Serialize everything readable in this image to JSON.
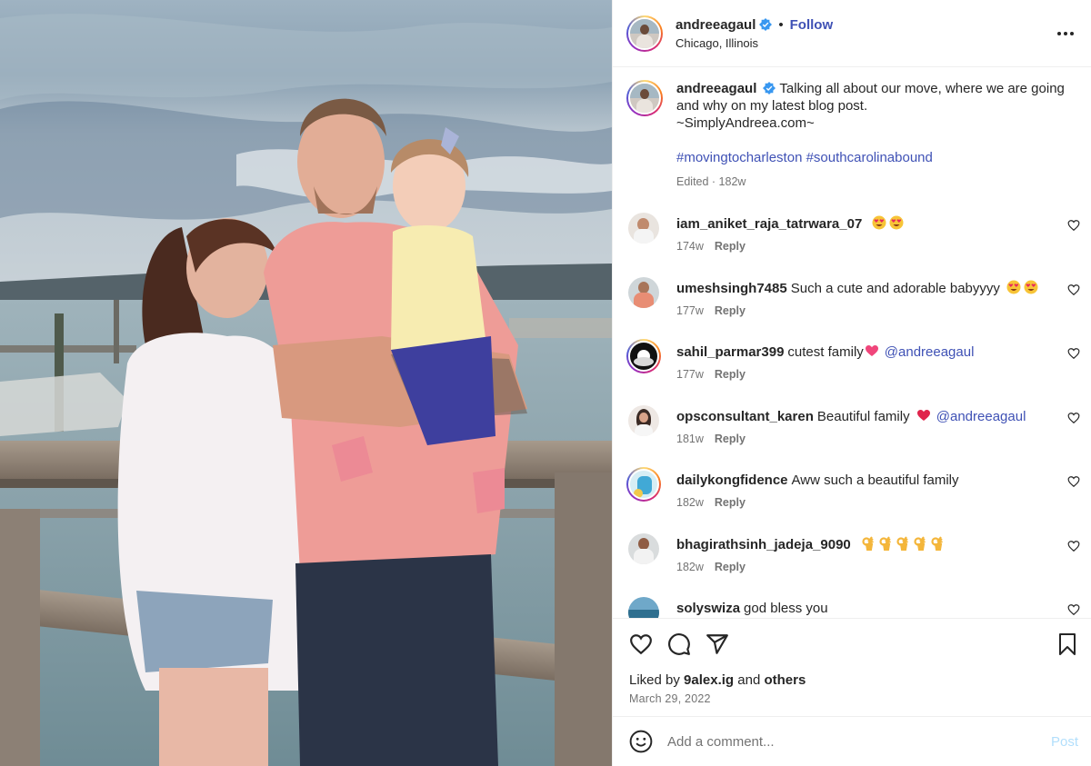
{
  "post": {
    "author": "andreeagaul",
    "location": "Chicago, Illinois",
    "follow_label": "Follow",
    "separator": "•",
    "caption": {
      "text_line": "Talking all about our move, where we are going and why on my latest blog post.",
      "site": "~SimplyAndreea.com~",
      "hashtags": "#movingtocharleston #southcarolinabound",
      "meta": "Edited · 182w"
    },
    "comments": [
      {
        "user": "iam_aniket_raja_tatrwara_07",
        "text": "",
        "emoji": [
          "heart-eyes",
          "heart-eyes"
        ],
        "mention": "",
        "age": "174w",
        "reply": "Reply"
      },
      {
        "user": "umeshsingh7485",
        "text": "Such a cute and adorable babyyyy",
        "emoji": [
          "heart-eyes",
          "heart-eyes"
        ],
        "mention": "",
        "age": "177w",
        "reply": "Reply"
      },
      {
        "user": "sahil_parmar399",
        "text": "cutest family",
        "emoji": [
          "pink-heart"
        ],
        "mention": "@andreeagaul",
        "age": "177w",
        "reply": "Reply"
      },
      {
        "user": "opsconsultant_karen",
        "text": "Beautiful family",
        "emoji": [
          "red-heart"
        ],
        "mention": "@andreeagaul",
        "age": "181w",
        "reply": "Reply"
      },
      {
        "user": "dailykongfidence",
        "text": "Aww such a beautiful family",
        "emoji": [],
        "mention": "",
        "age": "182w",
        "reply": "Reply"
      },
      {
        "user": "bhagirathsinh_jadeja_9090",
        "text": "",
        "emoji": [
          "ok-hand",
          "ok-hand",
          "ok-hand",
          "ok-hand",
          "ok-hand"
        ],
        "mention": "",
        "age": "182w",
        "reply": "Reply"
      },
      {
        "user": "solyswiza",
        "text": "god bless you",
        "emoji": [],
        "mention": "",
        "age": "",
        "reply": ""
      }
    ],
    "liked_by_prefix": "Liked by",
    "liked_by_user": "9alex.ig",
    "liked_by_and": "and",
    "liked_by_others": "others",
    "date": "March 29, 2022",
    "comment_placeholder": "Add a comment...",
    "post_button": "Post"
  },
  "icons": {
    "header_more": "more-options-icon",
    "verified": "verified-badge-icon",
    "like": "heart-icon",
    "comment": "comment-icon",
    "share": "share-icon",
    "save": "bookmark-icon",
    "emoji": "emoji-smile-icon"
  },
  "colors": {
    "link": "#3f51b5",
    "verified": "#3897f0",
    "muted": "#737373",
    "post_disabled": "#b2dffc"
  }
}
